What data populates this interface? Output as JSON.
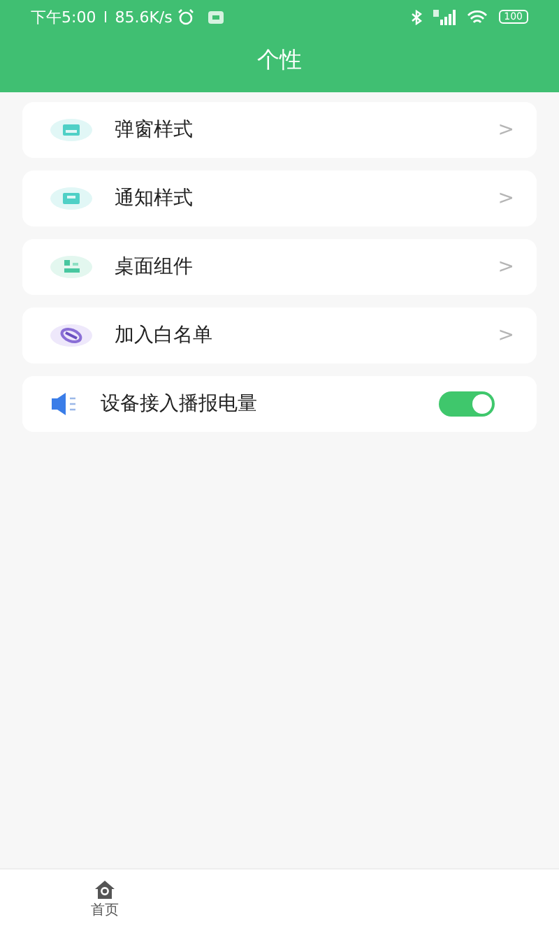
{
  "status_bar": {
    "time": "下午5:00",
    "speed": "85.6K/s",
    "battery": "100"
  },
  "header": {
    "title": "个性"
  },
  "settings": [
    {
      "kind": "link",
      "label": "弹窗样式",
      "chevron": ">"
    },
    {
      "kind": "link",
      "label": "通知样式",
      "chevron": ">"
    },
    {
      "kind": "link",
      "label": "桌面组件",
      "chevron": ">"
    },
    {
      "kind": "link",
      "label": "加入白名单",
      "chevron": ">"
    },
    {
      "kind": "toggle",
      "label": "设备接入播报电量",
      "on": true
    }
  ],
  "bottom_nav": [
    {
      "label": "首页"
    }
  ]
}
